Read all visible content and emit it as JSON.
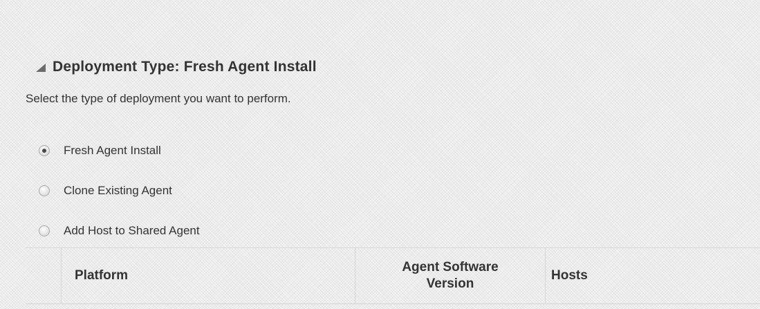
{
  "section": {
    "title": "Deployment Type: Fresh Agent Install",
    "disclosure_icon": "triangle-expanded-icon",
    "instruction": "Select the type of deployment you want to perform."
  },
  "deployment_options": [
    {
      "label": "Fresh Agent Install",
      "checked": true
    },
    {
      "label": "Clone Existing Agent",
      "checked": false
    },
    {
      "label": "Add Host to Shared Agent",
      "checked": false
    }
  ],
  "table": {
    "columns": [
      "Platform",
      "Agent Software\nVersion",
      "Hosts"
    ]
  },
  "colors": {
    "text": "#333333",
    "border": "#d6d6d6",
    "radio_dot": "#4a4a4a"
  }
}
